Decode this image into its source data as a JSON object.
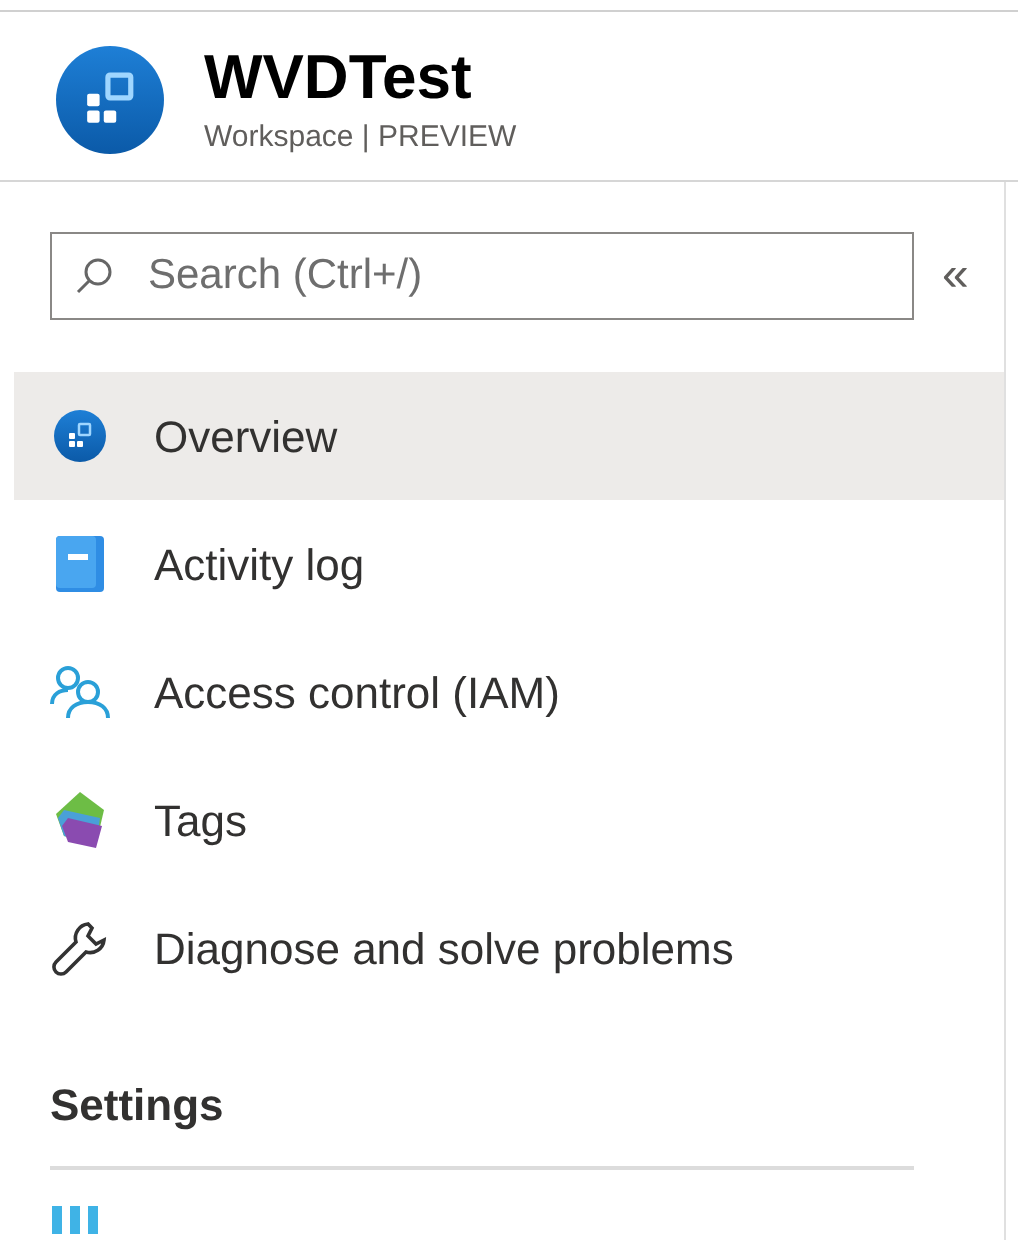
{
  "header": {
    "title": "WVDTest",
    "subtitle": "Workspace | PREVIEW"
  },
  "search": {
    "placeholder": "Search (Ctrl+/)"
  },
  "collapse": {
    "label": "«"
  },
  "menu": [
    {
      "label": "Overview",
      "kind": "overview",
      "selected": true
    },
    {
      "label": "Activity log",
      "kind": "log",
      "selected": false
    },
    {
      "label": "Access control (IAM)",
      "kind": "iam",
      "selected": false
    },
    {
      "label": "Tags",
      "kind": "tags",
      "selected": false
    },
    {
      "label": "Diagnose and solve problems",
      "kind": "diagnose",
      "selected": false
    }
  ],
  "sections": [
    {
      "title": "Settings",
      "items": [
        {
          "kind": "properties"
        }
      ]
    }
  ]
}
